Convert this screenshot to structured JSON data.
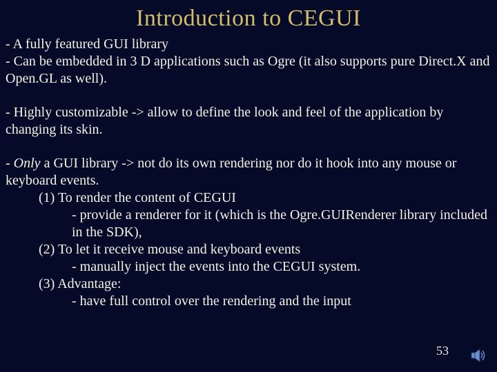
{
  "title": "Introduction to CEGUI",
  "paragraphs": {
    "p1a": "- A fully featured GUI library",
    "p1b": "- Can be embedded in 3 D applications such as Ogre (it also supports pure Direct.X and Open.GL as well).",
    "p2": "- Highly customizable -> allow to define the look and feel of the application by changing its skin.",
    "p3_prefix": "- ",
    "p3_em": "Only",
    "p3_rest": " a GUI library -> not do its own rendering nor do it hook into any mouse or keyboard events.",
    "p3_i1a": "(1) To render the content of CEGUI",
    "p3_i1a_sub": "- provide a renderer for it (which is the Ogre.GUIRenderer library included in the SDK),",
    "p3_i1b": "(2) To let it receive mouse and keyboard events",
    "p3_i1b_sub": "- manually inject the events into the CEGUI system.",
    "p3_i1c": "(3) Advantage:",
    "p3_i1c_sub": "- have full control over the rendering and the input"
  },
  "page_number": "53"
}
